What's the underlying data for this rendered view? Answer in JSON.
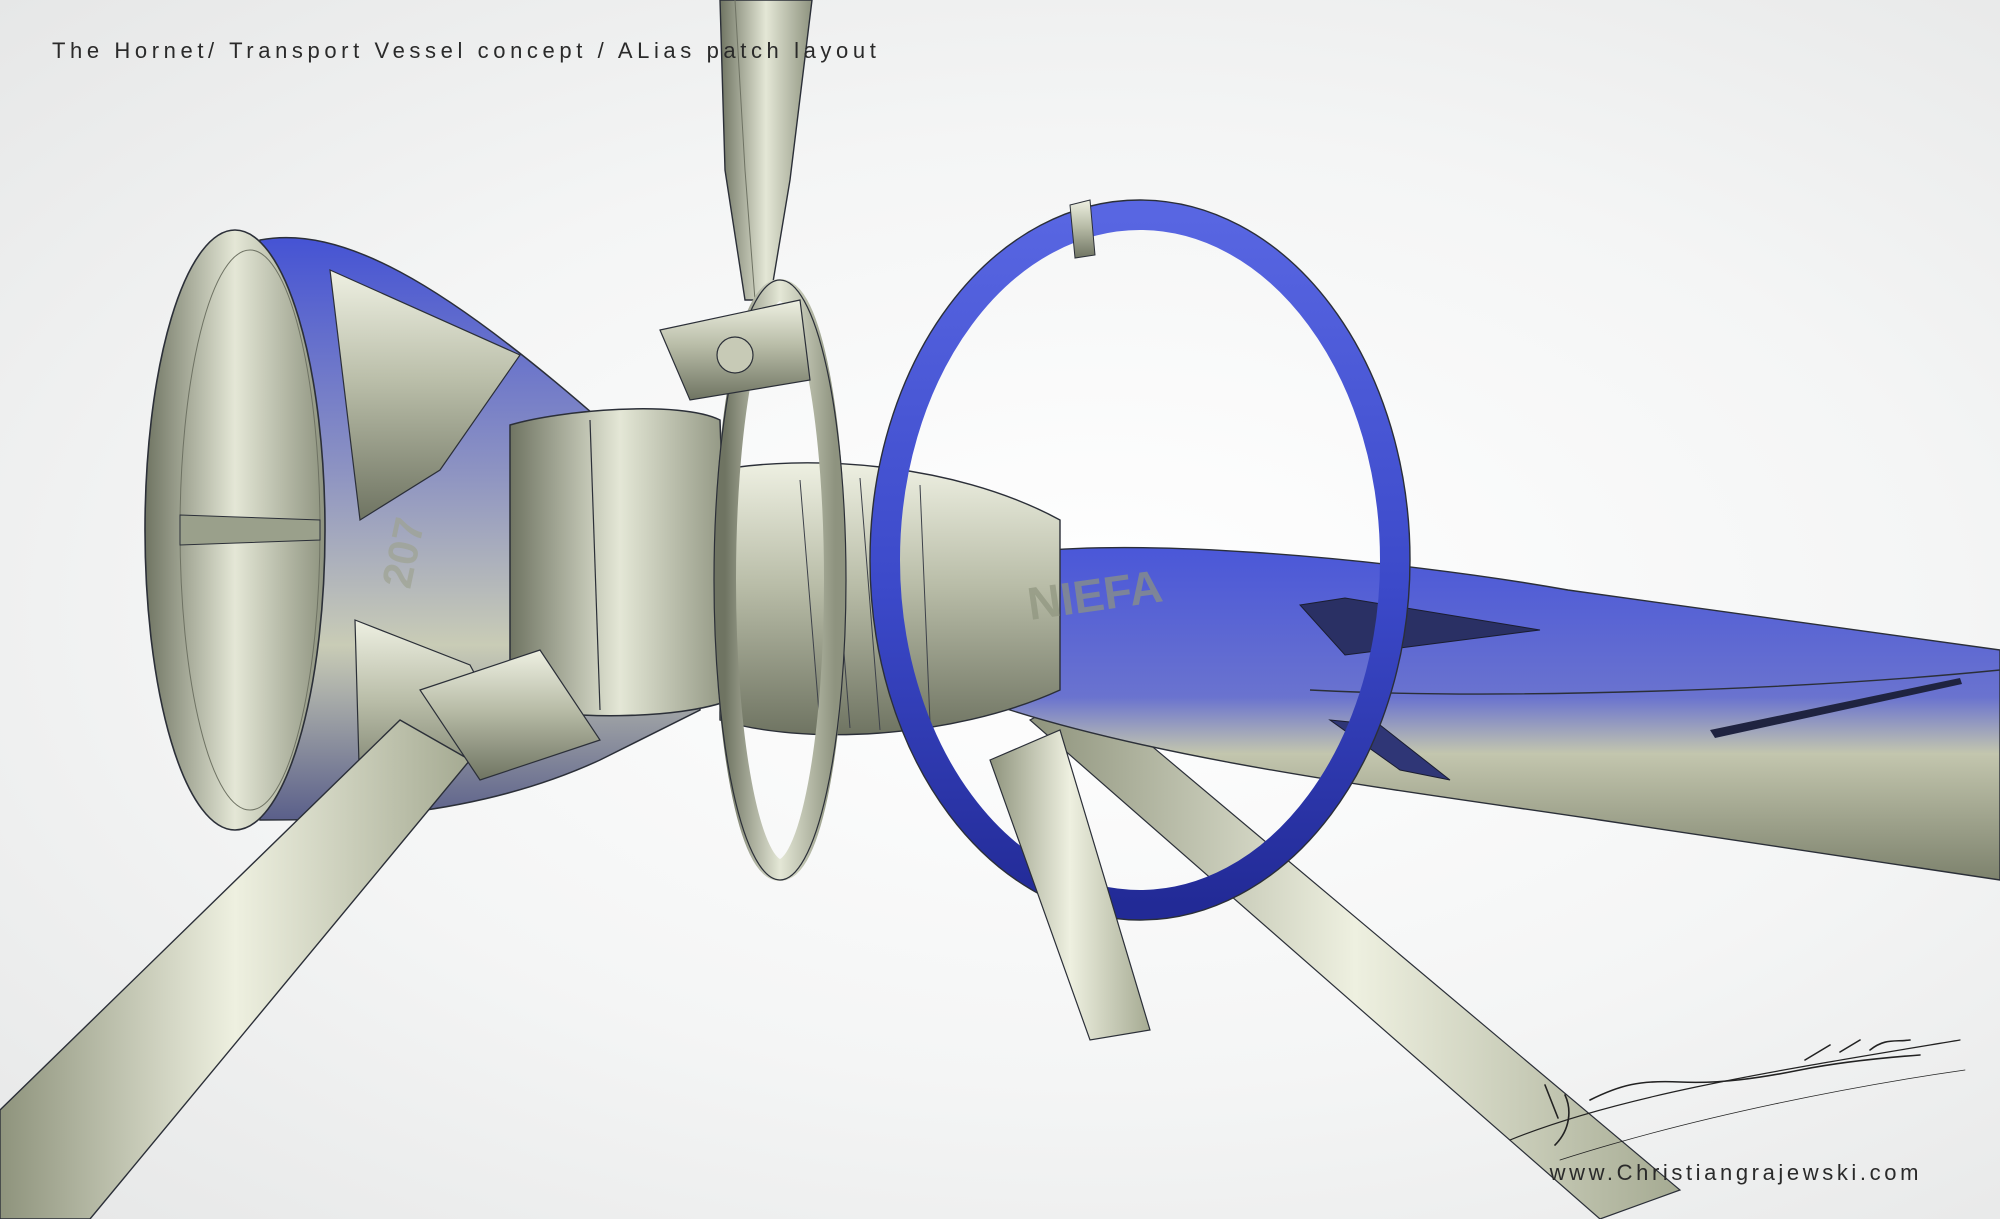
{
  "caption": {
    "title": "The  Hornet/ Transport Vessel concept / ALias patch layout",
    "website": "www.Christiangrajewski.com"
  },
  "artwork": {
    "signature": "by Christian Grajewski",
    "hull_markings": [
      "207",
      "NIEFA"
    ]
  },
  "palette": {
    "metal_light": "#e2e5d2",
    "metal_mid": "#a8ad98",
    "metal_dark": "#6e7263",
    "blue": "#3f4fd2",
    "blue_dark": "#2630a2",
    "outline": "#2b2f38",
    "background": "#f1f2f2"
  }
}
